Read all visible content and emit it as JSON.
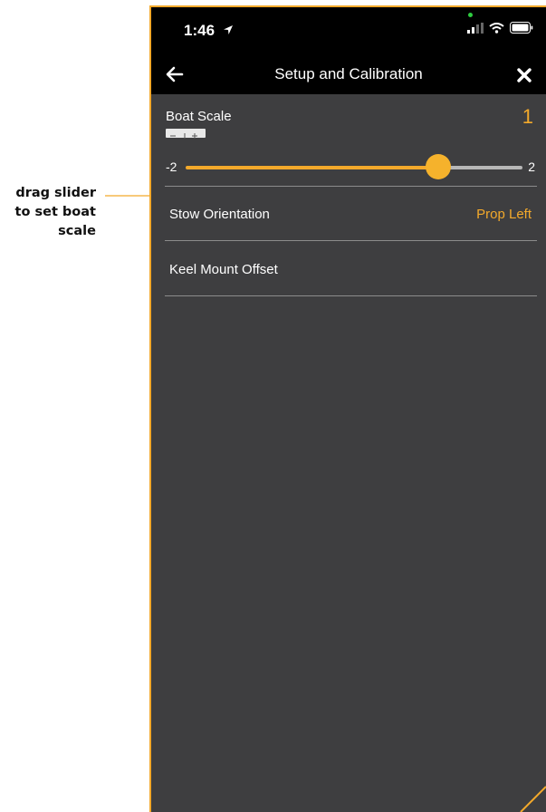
{
  "annotation": {
    "callout_lines": [
      "drag slider",
      "to set boat",
      "scale"
    ]
  },
  "statusbar": {
    "time": "1:46",
    "icons": [
      "location-arrow-icon",
      "signal-icon",
      "wifi-icon",
      "battery-icon"
    ]
  },
  "navbar": {
    "back_icon": "back-arrow-icon",
    "title": "Setup and Calibration",
    "close_icon": "close-icon"
  },
  "boat_scale": {
    "label": "Boat Scale",
    "value": "1",
    "scale_icon": "minus-plus-scale-icon",
    "slider": {
      "min_label": "-2",
      "max_label": "2",
      "min": -2,
      "max": 2,
      "value": 1
    }
  },
  "settings": [
    {
      "label": "Stow Orientation",
      "value": "Prop Left"
    },
    {
      "label": "Keel Mount Offset",
      "value": ""
    }
  ],
  "colors": {
    "accent": "#f3a92b",
    "background": "#3e3e40",
    "header": "#000000",
    "text": "#ffffff",
    "track_inactive": "#b7b7b7"
  }
}
